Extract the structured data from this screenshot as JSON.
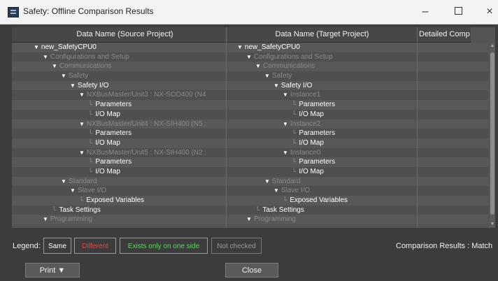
{
  "window": {
    "title": "Safety: Offline Comparison Results",
    "minimize": "–",
    "close": "×"
  },
  "columns": {
    "source": "Data Name (Source Project)",
    "target": "Data Name (Target Project)",
    "detail": "Detailed Comp"
  },
  "rows": [
    {
      "src": "new_SafetyCPU0",
      "tgt": "new_SafetyCPU0",
      "indent": 0,
      "tri": true,
      "dim": false
    },
    {
      "src": "Configurations and Setup",
      "tgt": "Configurations and Setup",
      "indent": 1,
      "tri": true,
      "dim": true
    },
    {
      "src": "Communications",
      "tgt": "Communications",
      "indent": 2,
      "tri": true,
      "dim": true
    },
    {
      "src": "Safety",
      "tgt": "Safety",
      "indent": 3,
      "tri": true,
      "dim": true
    },
    {
      "src": "Safety I/O",
      "tgt": "Safety I/O",
      "indent": 4,
      "tri": true,
      "dim": false
    },
    {
      "src": "NXBusMaster/Unit3 : NX-SOD400 (N4",
      "tgt": "Instance1",
      "indent": 5,
      "tri": true,
      "dim": true
    },
    {
      "src": "Parameters",
      "tgt": "Parameters",
      "indent": 6,
      "tri": false,
      "dim": false
    },
    {
      "src": "I/O Map",
      "tgt": "I/O Map",
      "indent": 6,
      "tri": false,
      "dim": false
    },
    {
      "src": "NXBusMaster/Unit4 : NX-SIH400 (N5 :",
      "tgt": "Instance2",
      "indent": 5,
      "tri": true,
      "dim": true
    },
    {
      "src": "Parameters",
      "tgt": "Parameters",
      "indent": 6,
      "tri": false,
      "dim": false
    },
    {
      "src": "I/O Map",
      "tgt": "I/O Map",
      "indent": 6,
      "tri": false,
      "dim": false
    },
    {
      "src": "NXBusMaster/Unit5 : NX-SIH400 (N2 :",
      "tgt": "Instance0",
      "indent": 5,
      "tri": true,
      "dim": true
    },
    {
      "src": "Parameters",
      "tgt": "Parameters",
      "indent": 6,
      "tri": false,
      "dim": false
    },
    {
      "src": "I/O Map",
      "tgt": "I/O Map",
      "indent": 6,
      "tri": false,
      "dim": false
    },
    {
      "src": "Standard",
      "tgt": "Standard",
      "indent": 3,
      "tri": true,
      "dim": true
    },
    {
      "src": "Slave I/O",
      "tgt": "Slave I/O",
      "indent": 4,
      "tri": true,
      "dim": true
    },
    {
      "src": "Exposed Variables",
      "tgt": "Exposed Variables",
      "indent": 5,
      "tri": false,
      "dim": false
    },
    {
      "src": "Task Settings",
      "tgt": "Task Settings",
      "indent": 2,
      "tri": false,
      "dim": false
    },
    {
      "src": "Programming",
      "tgt": "Programming",
      "indent": 1,
      "tri": true,
      "dim": true
    }
  ],
  "legend": {
    "label": "Legend:",
    "same": "Same",
    "different": "Different",
    "exists_one_side": "Exists only on one side",
    "not_checked": "Not checked"
  },
  "comparison": {
    "text": "Comparison Results :  Match"
  },
  "buttons": {
    "print": "Print ▼",
    "close": "Close"
  },
  "colors": {
    "same": "#ffffff",
    "different": "#e04848",
    "exists_one_side": "#63d463",
    "not_checked": "#9a9a9a"
  }
}
